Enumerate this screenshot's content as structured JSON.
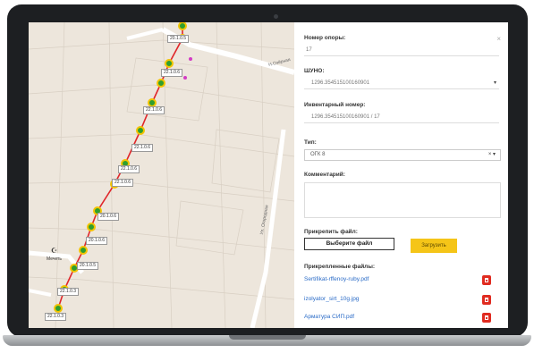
{
  "map": {
    "streets": [
      "Н.Озёрная",
      "Ул. Огородная"
    ],
    "poi": "Мечеть",
    "labels": [
      "20.1.0.5",
      "22.1.0.6",
      "22.1.0.6",
      "22.1.0.6",
      "22.1.0.6",
      "22.1.0.6",
      "20.1.0.6",
      "20.1.0.6",
      "20.1.0.5",
      "22.1.0.3",
      "22.1.0.3"
    ]
  },
  "panel": {
    "close_label": "×",
    "pole_number_label": "Номер опоры:",
    "pole_number_value": "17",
    "shuno_label": "ШУНО:",
    "shuno_value": "1296.354515100160901",
    "inventory_label": "Инвентарный номер:",
    "inventory_value": "1296.354515100160901 / 17",
    "type_label": "Тип:",
    "type_value": "ОГК 8",
    "type_caret": "× ▾",
    "shuno_caret": "▾",
    "comment_label": "Комментарий:",
    "attach_label": "Прикрепить файл:",
    "choose_file_label": "Выберите файл",
    "upload_label": "Загрузить",
    "attached_label": "Прикрепленные файлы:",
    "files": [
      "Sertifikat-rffenoy-ruby.pdf",
      "izolyator_sirt_10g.jpg",
      "Арматура СИП.pdf"
    ]
  },
  "colors": {
    "line": "#e0262a",
    "node_fill": "#2f9e2f",
    "node_ring": "#f2c400",
    "upload": "#f5c518",
    "delete": "#e02b20",
    "link": "#2a6bc7"
  }
}
